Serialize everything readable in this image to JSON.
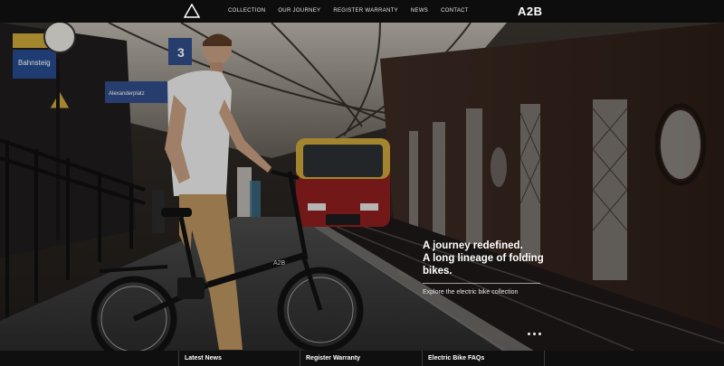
{
  "header": {
    "brand": "A2B",
    "logo_icon": "triangle-logo-icon",
    "nav": [
      {
        "label": "COLLECTION"
      },
      {
        "label": "OUR JOURNEY"
      },
      {
        "label": "REGISTER WARRANTY"
      },
      {
        "label": "NEWS"
      },
      {
        "label": "CONTACT"
      }
    ]
  },
  "hero": {
    "headline_1": "A journey redefined.",
    "headline_2": "A long lineage of folding",
    "headline_3": "bikes.",
    "cta": "Explore the electric bike collection",
    "slide_count": 3,
    "signs": {
      "sign_1": "Bahnsteig",
      "platform_number": "3",
      "sign_2": "Alexanderplatz",
      "bike_badge": "A2B"
    }
  },
  "footer": {
    "tabs": [
      {
        "label": "Latest News"
      },
      {
        "label": "Register Warranty"
      },
      {
        "label": "Electric Bike FAQs"
      }
    ]
  },
  "colors": {
    "topbar": "#0d0d0d",
    "train_red": "#8b1e1e",
    "train_yellow": "#c9a33a"
  }
}
